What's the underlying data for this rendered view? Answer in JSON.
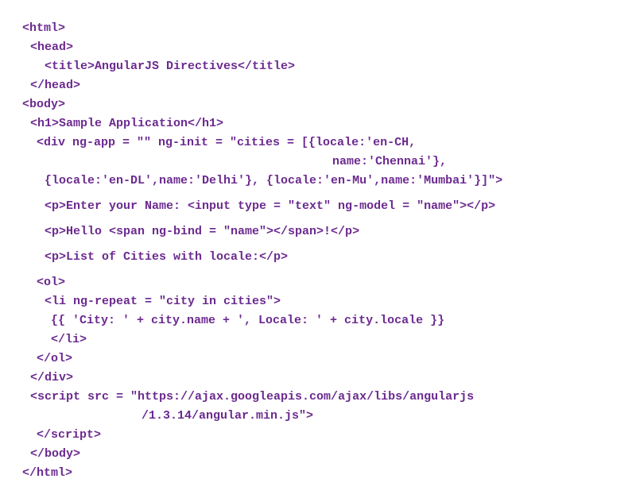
{
  "code": {
    "l1": "<html>",
    "l2": "<head>",
    "l3": "<title>AngularJS Directives</title>",
    "l4": "</head>",
    "l5": "<body>",
    "l6": "<h1>Sample Application</h1>",
    "l7": "<div ng-app = \"\" ng-init = \"cities = [{locale:'en-CH,",
    "l8": "name:'Chennai'},",
    "l9": "{locale:'en-DL',name:'Delhi'}, {locale:'en-Mu',name:'Mumbai'}]\">",
    "l10": "<p>Enter your Name: <input type = \"text\" ng-model = \"name\"></p>",
    "l11": "<p>Hello <span ng-bind = \"name\"></span>!</p>",
    "l12": "<p>List of Cities with locale:</p>",
    "l13": "<ol>",
    "l14": "<li ng-repeat = \"city in cities\">",
    "l15": "{{ 'City: ' + city.name + ', Locale: ' + city.locale }}",
    "l16": "</li>",
    "l17": "</ol>",
    "l18": "</div>",
    "l19": "<script src = \"https://ajax.googleapis.com/ajax/libs/angularjs",
    "l20": "/1.3.14/angular.min.js\">",
    "l21": "</script>",
    "l22": "</body>",
    "l23": "</html>"
  }
}
